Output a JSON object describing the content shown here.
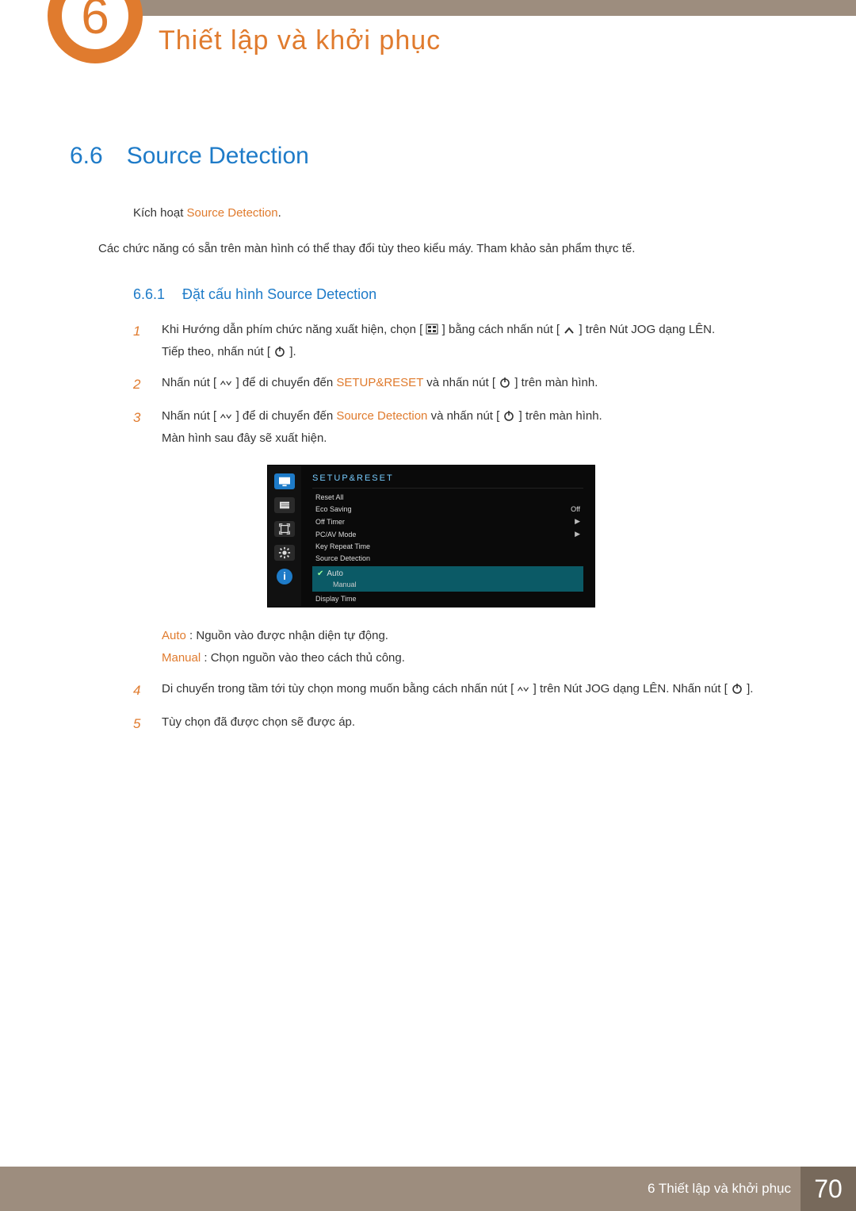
{
  "chapter": {
    "number": "6",
    "title": "Thiết lập và khởi phục"
  },
  "section": {
    "number": "6.6",
    "title": "Source Detection"
  },
  "intro_prefix": "Kích hoạt ",
  "intro_hl": "Source Detection",
  "intro_suffix": ".",
  "note": "Các chức năng có sẵn trên màn hình có thể thay đổi tùy theo kiểu máy. Tham khảo sản phẩm thực tế.",
  "subsection": {
    "number": "6.6.1",
    "title": "Đặt cấu hình Source Detection"
  },
  "steps": {
    "s1_a": "Khi Hướng dẫn phím chức năng xuất hiện, chọn [",
    "s1_b": "] bằng cách nhấn nút [",
    "s1_c": "] trên Nút JOG dạng LÊN.",
    "s1_next": "Tiếp theo, nhấn nút [",
    "s1_next_end": "].",
    "s2_a": "Nhấn nút [",
    "s2_b": "] để di chuyển đến ",
    "s2_hl": "SETUP&RESET",
    "s2_c": " và nhấn nút [",
    "s2_d": "] trên màn hình.",
    "s3_a": "Nhấn nút [",
    "s3_b": "] để di chuyển đến ",
    "s3_hl": "Source Detection",
    "s3_c": " và nhấn nút [",
    "s3_d": "] trên màn hình.",
    "s3_after": "Màn hình sau đây sẽ xuất hiện.",
    "auto_label": "Auto",
    "auto_desc": " : Nguồn vào được nhận diện tự động.",
    "manual_label": "Manual",
    "manual_desc": " : Chọn nguồn vào theo cách thủ công.",
    "s4_a": "Di chuyển trong tầm tới tùy chọn mong muốn bằng cách nhấn nút [",
    "s4_b": "] trên Nút JOG dạng LÊN. Nhấn nút [",
    "s4_c": "].",
    "s5": "Tùy chọn đã được chọn sẽ được áp."
  },
  "menu": {
    "title": "SETUP&RESET",
    "items": [
      {
        "label": "Reset All"
      },
      {
        "label": "Eco Saving",
        "value": "Off"
      },
      {
        "label": "Off Timer",
        "arrow": true
      },
      {
        "label": "PC/AV Mode",
        "arrow": true
      },
      {
        "label": "Key Repeat Time"
      },
      {
        "label": "Source Detection",
        "highlight": true,
        "selected": "Auto",
        "alt": "Manual"
      },
      {
        "label": "Display Time"
      }
    ]
  },
  "footer": {
    "text": "6 Thiết lập và khởi phục",
    "page": "70"
  },
  "icons": {
    "menu": "menu-grid-icon",
    "up": "chevron-up-icon",
    "power": "power-icon",
    "updown": "chevron-up-down-icon"
  }
}
